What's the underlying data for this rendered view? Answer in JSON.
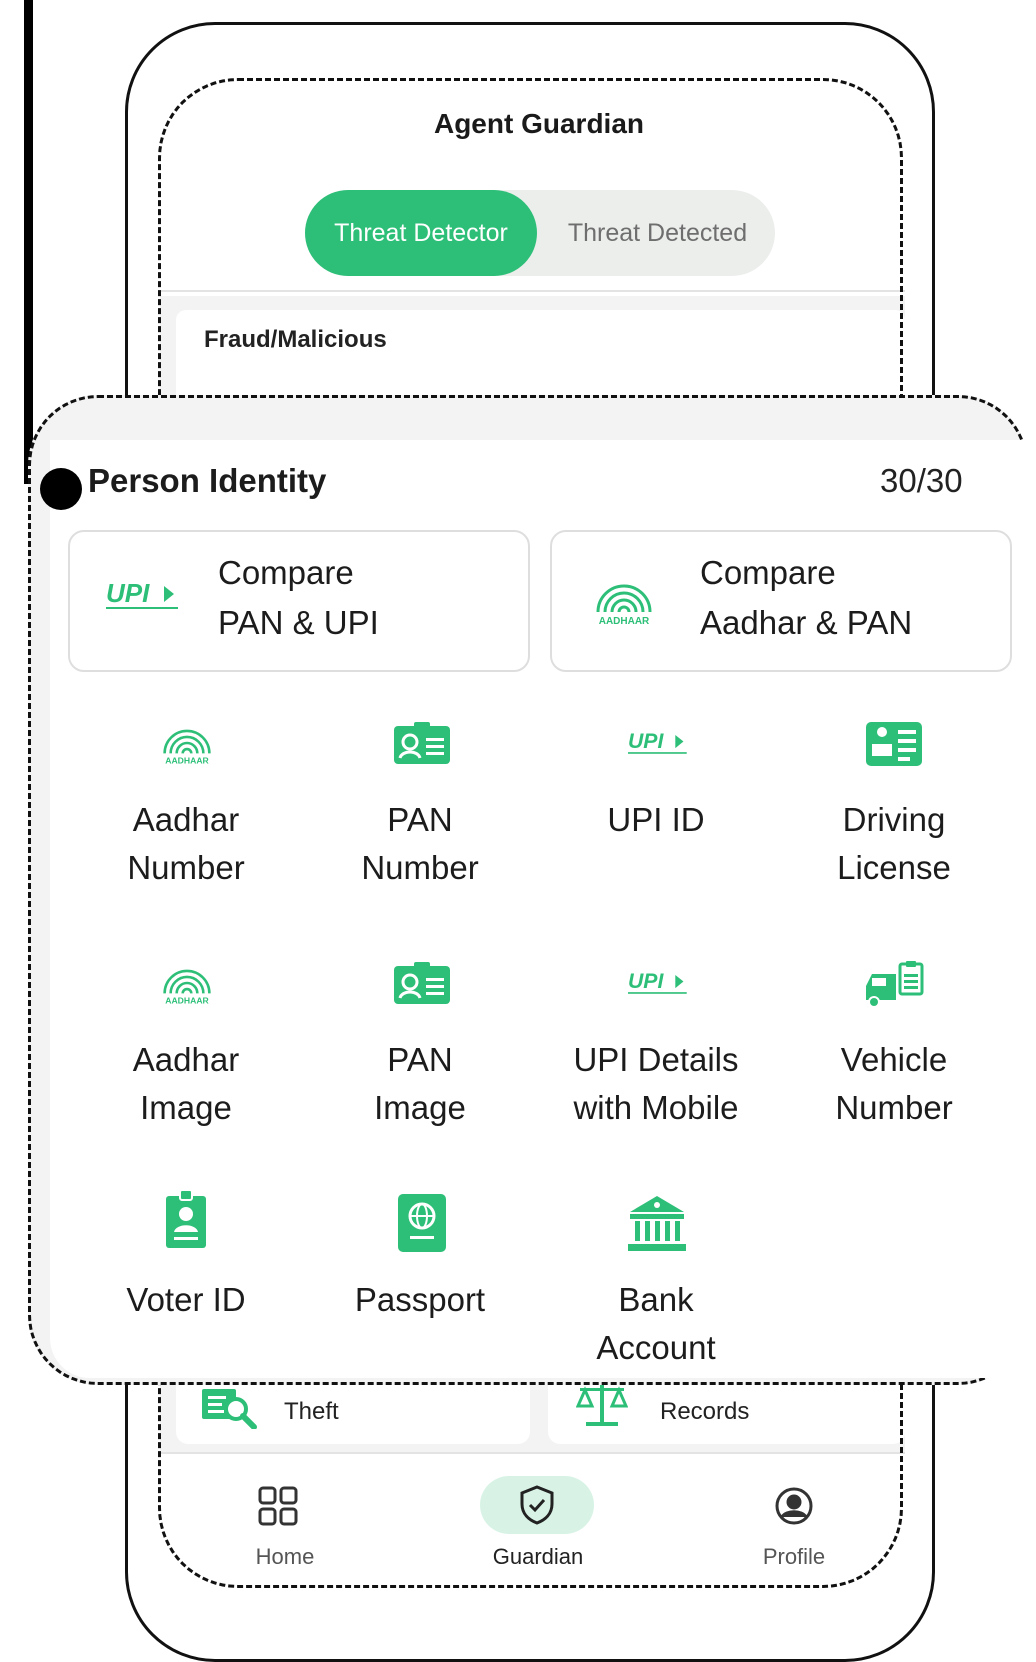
{
  "app": {
    "title": "Agent Guardian"
  },
  "segments": {
    "active": "Threat Detector",
    "inactive": "Threat Detected"
  },
  "background_section": {
    "label": "Fraud/Malicious"
  },
  "background_cards": {
    "left_label": "Theft",
    "right_label": "Records"
  },
  "panel": {
    "title": "Person Identity",
    "count": "30/30",
    "compare_cards": [
      {
        "line1": "Compare",
        "line2": "PAN & UPI",
        "icon": "upi-logo-icon"
      },
      {
        "line1": "Compare",
        "line2": "Aadhar & PAN",
        "icon": "aadhaar-logo-icon"
      }
    ],
    "tiles": [
      {
        "line1": "Aadhar",
        "line2": "Number",
        "icon": "aadhaar-logo-icon"
      },
      {
        "line1": "PAN",
        "line2": "Number",
        "icon": "pan-card-icon"
      },
      {
        "line1": "UPI ID",
        "line2": "",
        "icon": "upi-logo-icon"
      },
      {
        "line1": "Driving",
        "line2": "License",
        "icon": "driving-license-icon"
      },
      {
        "line1": "Aadhar",
        "line2": "Image",
        "icon": "aadhaar-logo-icon"
      },
      {
        "line1": "PAN",
        "line2": "Image",
        "icon": "pan-card-icon"
      },
      {
        "line1": "UPI Details",
        "line2": "with Mobile",
        "icon": "upi-logo-icon"
      },
      {
        "line1": "Vehicle",
        "line2": "Number",
        "icon": "vehicle-icon"
      },
      {
        "line1": "Voter ID",
        "line2": "",
        "icon": "voter-id-icon"
      },
      {
        "line1": "Passport",
        "line2": "",
        "icon": "passport-icon"
      },
      {
        "line1": "Bank",
        "line2": "Account",
        "icon": "bank-icon"
      }
    ]
  },
  "bottom_nav": {
    "items": [
      {
        "label": "Home",
        "icon": "home-grid-icon"
      },
      {
        "label": "Guardian",
        "icon": "shield-check-icon"
      },
      {
        "label": "Profile",
        "icon": "profile-icon"
      }
    ],
    "active": "Guardian"
  },
  "colors": {
    "accent": "#2dbf78",
    "accent_light": "#d8f3e6",
    "text": "#1c1c1c",
    "muted": "#6e6e6e"
  }
}
